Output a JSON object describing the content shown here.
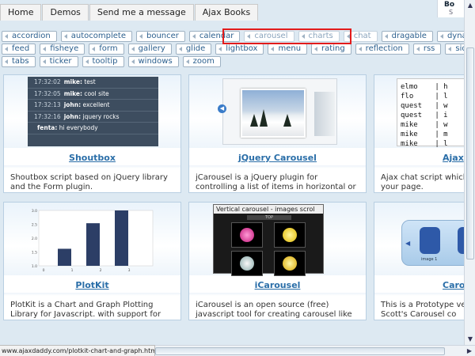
{
  "top_nav": [
    "Home",
    "Demos",
    "Send me a message",
    "Ajax Books"
  ],
  "corner_widget": {
    "label": "Bo",
    "sub": "S"
  },
  "tag_rows": [
    [
      "accordion",
      "autocomplete",
      "bouncer",
      "calendar",
      "carousel",
      "charts",
      "chat",
      "dragable",
      "dynamic-conte"
    ],
    [
      "feed",
      "fisheye",
      "form",
      "gallery",
      "glide",
      "lightbox",
      "menu",
      "rating",
      "reflection",
      "rss",
      "sidenotes",
      "st"
    ],
    [
      "tabs",
      "ticker",
      "tooltip",
      "windows",
      "zoom"
    ]
  ],
  "highlighted_tags": [
    "carousel",
    "charts",
    "chat"
  ],
  "cards": [
    {
      "id": "shoutbox",
      "title": "Shoutbox",
      "desc": "Shoutbox script based on jQuery library and the Form plugin."
    },
    {
      "id": "jcarousel",
      "title": "jQuery Carousel",
      "desc": "jCarousel is a jQuery plugin for controlling a list of items in horizontal or vertical order."
    },
    {
      "id": "ajaxchat",
      "title": "Ajax ",
      "desc": "Ajax chat script which y in your page."
    },
    {
      "id": "plotkit",
      "title": "PlotKit",
      "desc": "PlotKit is a Chart and Graph Plotting Library for Javascript. with support for HTML Canvas."
    },
    {
      "id": "icarousel",
      "title": "iCarousel",
      "desc": "iCarousel is an open source (free) javascript tool for creating carousel like widgets."
    },
    {
      "id": "carousel2",
      "title": "Caro",
      "desc": "This is a Prototype ver Bill Scott's Carousel co"
    }
  ],
  "shoutbox_lines": [
    {
      "time": "17:32:02",
      "name": "mike:",
      "msg": "test"
    },
    {
      "time": "17:32:05",
      "name": "mike:",
      "msg": "cool site"
    },
    {
      "time": "17:32:13",
      "name": "john:",
      "msg": "excellent"
    },
    {
      "time": "17:32:16",
      "name": "john:",
      "msg": "jquery rocks"
    },
    {
      "time": "",
      "name": "fenta:",
      "msg": "hi everybody"
    }
  ],
  "chat_lines": [
    "elmo    | h",
    "flo     | l",
    "quest   | w",
    "quest   | i",
    "mike    | w",
    "mike    | m",
    "mike    | l"
  ],
  "plot_chart": {
    "yticks": [
      "1.0",
      "1.5",
      "2.0",
      "2.5",
      "3.0"
    ],
    "xticks": [
      "0",
      "1",
      "2",
      "3"
    ],
    "bar_values": [
      1.2,
      2.4,
      3.0
    ]
  },
  "icarousel_caption": "Vertical carousel - images scrol",
  "icarousel_topbar": "TOP",
  "carousel2_label": "image 1",
  "status_url": "www.ajaxdaddy.com/plotkit-chart-and-graph.html"
}
